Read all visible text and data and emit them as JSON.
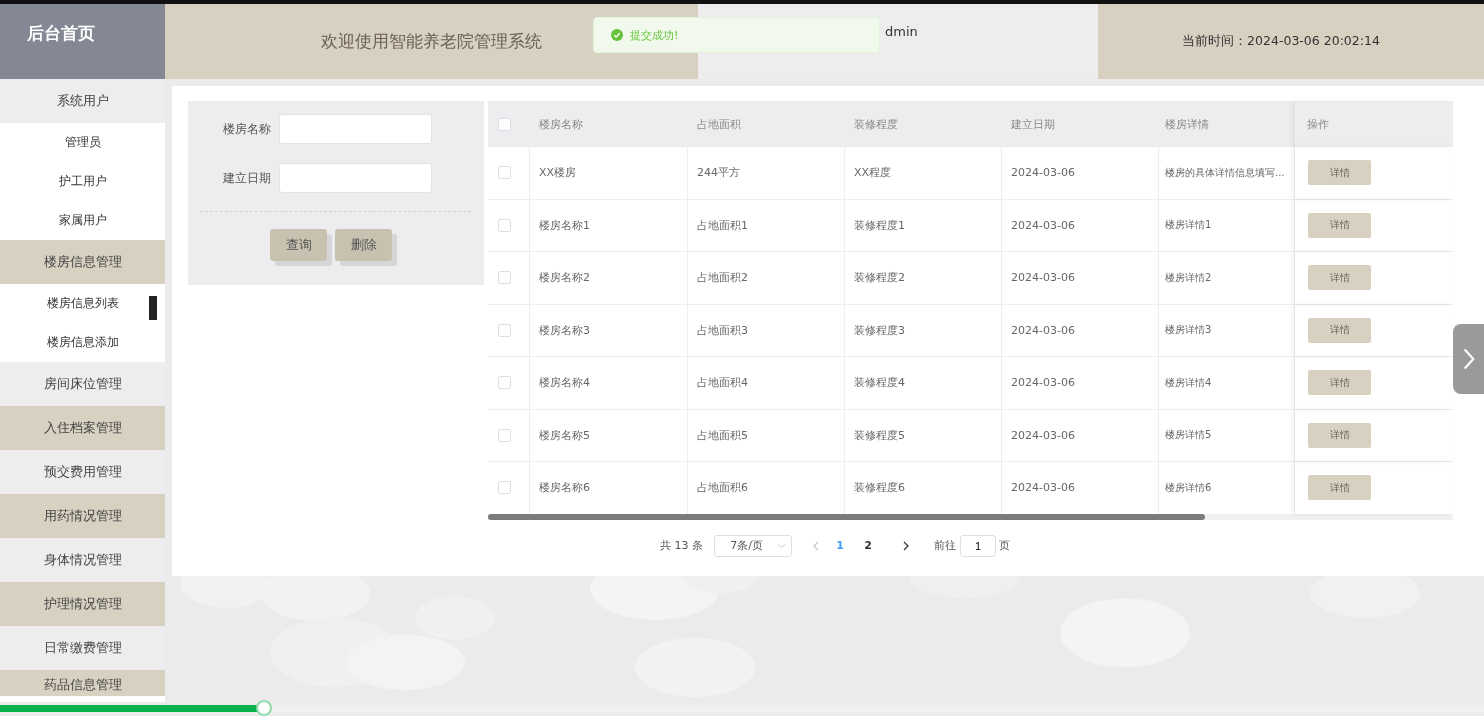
{
  "sidebar": {
    "title": "后台首页",
    "groups": [
      {
        "label": "系统用户",
        "children": [
          {
            "label": "管理员",
            "selected": false
          },
          {
            "label": "护工用户",
            "selected": false
          },
          {
            "label": "家属用户",
            "selected": false
          }
        ]
      },
      {
        "label": "楼房信息管理",
        "children": [
          {
            "label": "楼房信息列表",
            "selected": true
          },
          {
            "label": "楼房信息添加",
            "selected": false
          }
        ]
      },
      {
        "label": "房间床位管理"
      },
      {
        "label": "入住档案管理"
      },
      {
        "label": "预交费用管理"
      },
      {
        "label": "用药情况管理"
      },
      {
        "label": "身体情况管理"
      },
      {
        "label": "护理情况管理"
      },
      {
        "label": "日常缴费管理"
      },
      {
        "label": "药品信息管理"
      }
    ]
  },
  "header": {
    "title": "欢迎使用智能养老院管理系统",
    "user": "dmin",
    "time": "当前时间：2024-03-06 20:02:14"
  },
  "toast": {
    "message": "提交成功!"
  },
  "search_form": {
    "fields": [
      {
        "label": "楼房名称"
      },
      {
        "label": "建立日期"
      }
    ],
    "buttons": [
      "查询",
      "删除"
    ]
  },
  "table": {
    "select_all_checked": false,
    "columns": [
      "楼房名称",
      "占地面积",
      "装修程度",
      "建立日期",
      "楼房详情",
      "操作"
    ],
    "rows": [
      {
        "checked": false,
        "cells": [
          "XX楼房",
          "244平方",
          "XX程度",
          "2024-03-06",
          "楼房的具体详情信息填写..."
        ],
        "action": "详情"
      },
      {
        "checked": false,
        "cells": [
          "楼房名称1",
          "占地面积1",
          "装修程度1",
          "2024-03-06",
          "楼房详情1"
        ],
        "action": "详情"
      },
      {
        "checked": false,
        "cells": [
          "楼房名称2",
          "占地面积2",
          "装修程度2",
          "2024-03-06",
          "楼房详情2"
        ],
        "action": "详情"
      },
      {
        "checked": false,
        "cells": [
          "楼房名称3",
          "占地面积3",
          "装修程度3",
          "2024-03-06",
          "楼房详情3"
        ],
        "action": "详情"
      },
      {
        "checked": false,
        "cells": [
          "楼房名称4",
          "占地面积4",
          "装修程度4",
          "2024-03-06",
          "楼房详情4"
        ],
        "action": "详情"
      },
      {
        "checked": false,
        "cells": [
          "楼房名称5",
          "占地面积5",
          "装修程度5",
          "2024-03-06",
          "楼房详情5"
        ],
        "action": "详情"
      },
      {
        "checked": false,
        "cells": [
          "楼房名称6",
          "占地面积6",
          "装修程度6",
          "2024-03-06",
          "楼房详情6"
        ],
        "action": "详情"
      }
    ]
  },
  "pagination": {
    "total": "共 13 条",
    "page_size": "7条/页",
    "pages": [
      {
        "label": "1",
        "selected": true
      },
      {
        "label": "2",
        "selected": false
      }
    ],
    "goto_label": "前往",
    "goto_value": "1",
    "goto_suffix": "页"
  },
  "video_progress": {
    "level": 0.178
  }
}
